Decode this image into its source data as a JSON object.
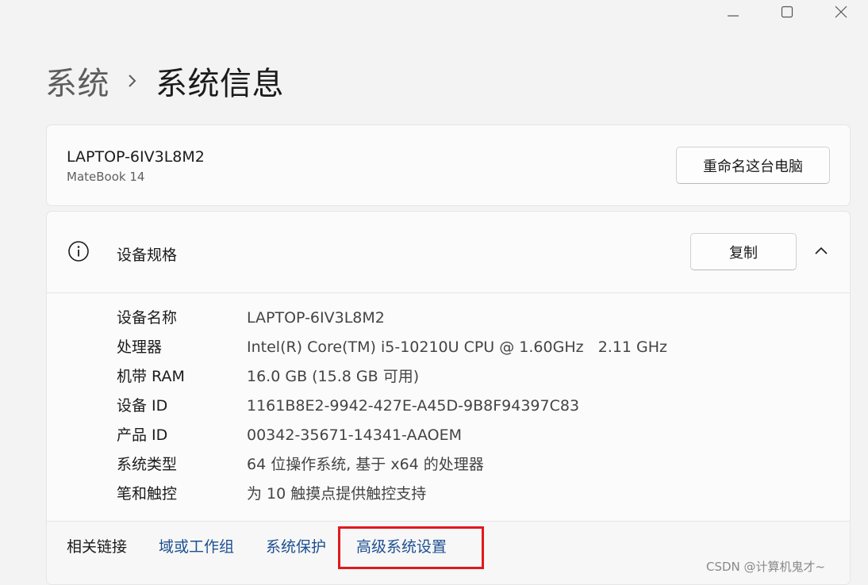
{
  "window": {
    "controls": [
      "minimize-icon",
      "maximize-icon",
      "close-icon"
    ]
  },
  "breadcrumb": {
    "parent": "系统",
    "separator_icon": "chevron-right-icon",
    "current": "系统信息"
  },
  "pc_card": {
    "device_name": "LAPTOP-6IV3L8M2",
    "model": "MateBook 14",
    "rename_button": "重命名这台电脑"
  },
  "specs_card": {
    "icon": "info-icon",
    "title": "设备规格",
    "copy_button": "复制",
    "collapse_icon": "chevron-up-icon",
    "rows": [
      {
        "label": "设备名称",
        "value": "LAPTOP-6IV3L8M2"
      },
      {
        "label": "处理器",
        "value": "Intel(R) Core(TM) i5-10210U CPU @ 1.60GHz   2.11 GHz"
      },
      {
        "label": "机带 RAM",
        "value": "16.0 GB (15.8 GB 可用)"
      },
      {
        "label": "设备 ID",
        "value": "1161B8E2-9942-427E-A45D-9B8F94397C83"
      },
      {
        "label": "产品 ID",
        "value": "00342-35671-14341-AAOEM"
      },
      {
        "label": "系统类型",
        "value": "64 位操作系统, 基于 x64 的处理器"
      },
      {
        "label": "笔和触控",
        "value": "为 10 触摸点提供触控支持"
      }
    ]
  },
  "related": {
    "label": "相关链接",
    "links": [
      "域或工作组",
      "系统保护",
      "高级系统设置"
    ],
    "highlight_color": "#e0191d"
  },
  "colors": {
    "link": "#1d4f91",
    "background": "#f3f3f3",
    "card": "#fbfbfb"
  },
  "watermark": "CSDN @计算机鬼才~"
}
